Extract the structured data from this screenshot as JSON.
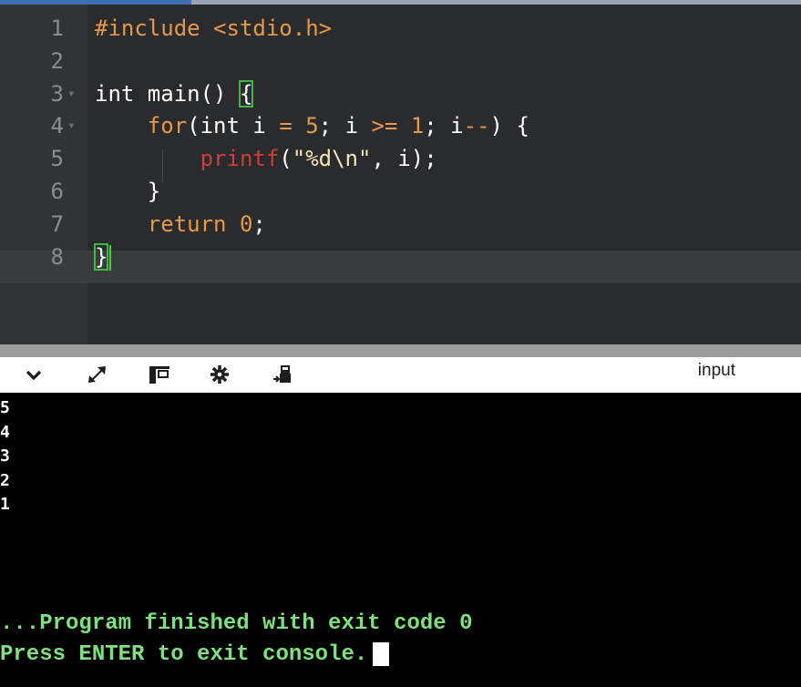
{
  "editor": {
    "lines": [
      {
        "n": "1",
        "fold": "",
        "parts": [
          {
            "t": "#include <stdio.h>",
            "c": "inc"
          }
        ]
      },
      {
        "n": "2",
        "fold": "",
        "parts": []
      },
      {
        "n": "3",
        "fold": "▾",
        "parts": [
          {
            "t": "int main() ",
            "c": "kw"
          },
          {
            "t": "{",
            "c": "kw bracket"
          }
        ]
      },
      {
        "n": "4",
        "fold": "▾",
        "parts": [
          {
            "t": "    ",
            "c": ""
          },
          {
            "t": "for",
            "c": "or"
          },
          {
            "t": "(int i ",
            "c": "kw"
          },
          {
            "t": "=",
            "c": "or"
          },
          {
            "t": " ",
            "c": ""
          },
          {
            "t": "5",
            "c": "nm"
          },
          {
            "t": "; i ",
            "c": "kw"
          },
          {
            "t": ">=",
            "c": "or"
          },
          {
            "t": " ",
            "c": ""
          },
          {
            "t": "1",
            "c": "nm"
          },
          {
            "t": "; i",
            "c": "kw"
          },
          {
            "t": "--",
            "c": "or"
          },
          {
            "t": ") {",
            "c": "kw"
          }
        ]
      },
      {
        "n": "5",
        "fold": "",
        "parts": [
          {
            "t": "        ",
            "c": ""
          },
          {
            "t": "printf",
            "c": "pf"
          },
          {
            "t": "(",
            "c": "kw"
          },
          {
            "t": "\"%d\\n\"",
            "c": "st"
          },
          {
            "t": ", i);",
            "c": "kw"
          }
        ]
      },
      {
        "n": "6",
        "fold": "",
        "parts": [
          {
            "t": "    }",
            "c": "kw"
          }
        ]
      },
      {
        "n": "7",
        "fold": "",
        "parts": [
          {
            "t": "    ",
            "c": ""
          },
          {
            "t": "return",
            "c": "or"
          },
          {
            "t": " ",
            "c": ""
          },
          {
            "t": "0",
            "c": "nm"
          },
          {
            "t": ";",
            "c": "kw"
          }
        ]
      },
      {
        "n": "8",
        "fold": "",
        "parts": [
          {
            "t": "}",
            "c": "kw bracket"
          }
        ]
      }
    ]
  },
  "toolbar": {
    "input_label": "input",
    "icons": [
      "chevron-down-icon",
      "expand-icon",
      "split-view-icon",
      "gear-icon",
      "clear-console-icon"
    ]
  },
  "console": {
    "output": [
      "5",
      "4",
      "3",
      "2",
      "1"
    ],
    "finished": "...Program finished with exit code 0",
    "press_enter": "Press ENTER to exit console."
  }
}
